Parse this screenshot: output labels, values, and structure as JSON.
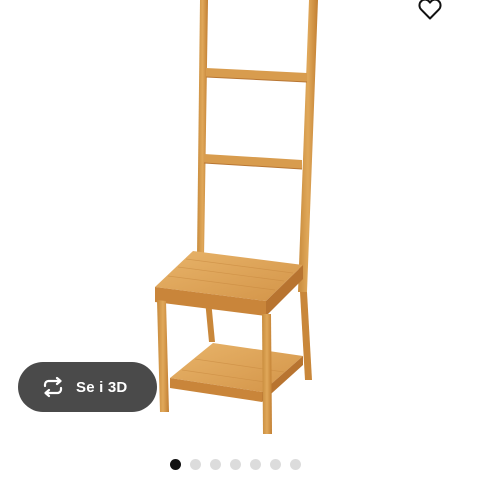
{
  "gallery": {
    "view_3d_label": "Se i 3D",
    "image_count": 7,
    "active_index": 0,
    "icons": {
      "favourite": "heart-outline-icon",
      "view_3d": "rotate-3d-icon"
    }
  },
  "colors": {
    "pill_background": "#4a4a4a",
    "dot_active": "#111111",
    "dot_inactive": "#dcdcdc"
  }
}
